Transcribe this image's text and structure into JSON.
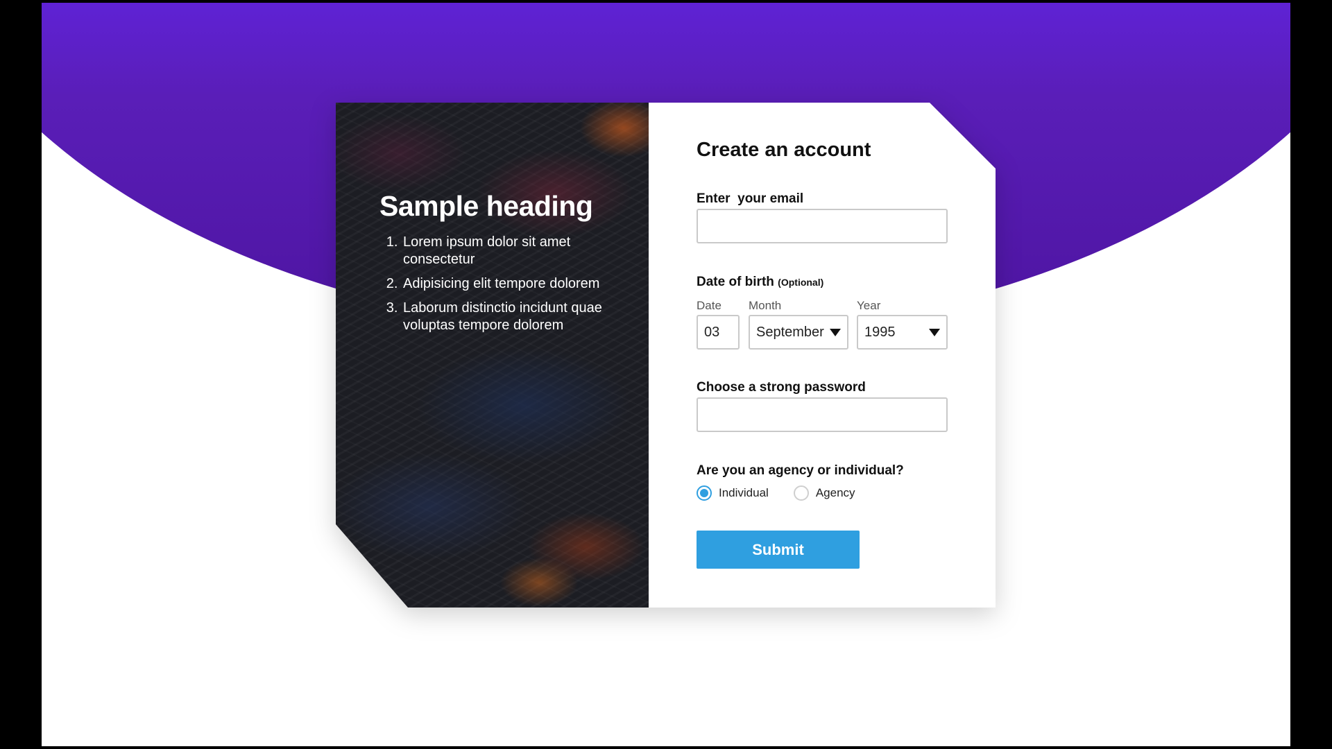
{
  "colors": {
    "hero_top": "#6a2cff",
    "hero_bottom": "#4d14a0",
    "accent": "#2f9fe0",
    "page_background": "#ffffff"
  },
  "art": {
    "heading": "Sample heading",
    "items": [
      "Lorem ipsum dolor sit amet consectetur",
      "Adipisicing elit tempore dolorem",
      "Laborum distinctio incidunt quae voluptas tempore dolorem"
    ]
  },
  "form": {
    "title": "Create an account",
    "email": {
      "label": "Enter  your email",
      "value": "",
      "placeholder": ""
    },
    "dob": {
      "label": "Date of birth",
      "optional": "(Optional)",
      "date_label": "Date",
      "date_value": "03",
      "month_label": "Month",
      "month_value": "September",
      "year_label": "Year",
      "year_value": "1995"
    },
    "password": {
      "label": "Choose a strong password",
      "value": "",
      "placeholder": ""
    },
    "type": {
      "label": "Are you an agency or individual?",
      "options": [
        {
          "label": "Individual",
          "checked": true
        },
        {
          "label": "Agency",
          "checked": false
        }
      ]
    },
    "submit_label": "Submit"
  }
}
